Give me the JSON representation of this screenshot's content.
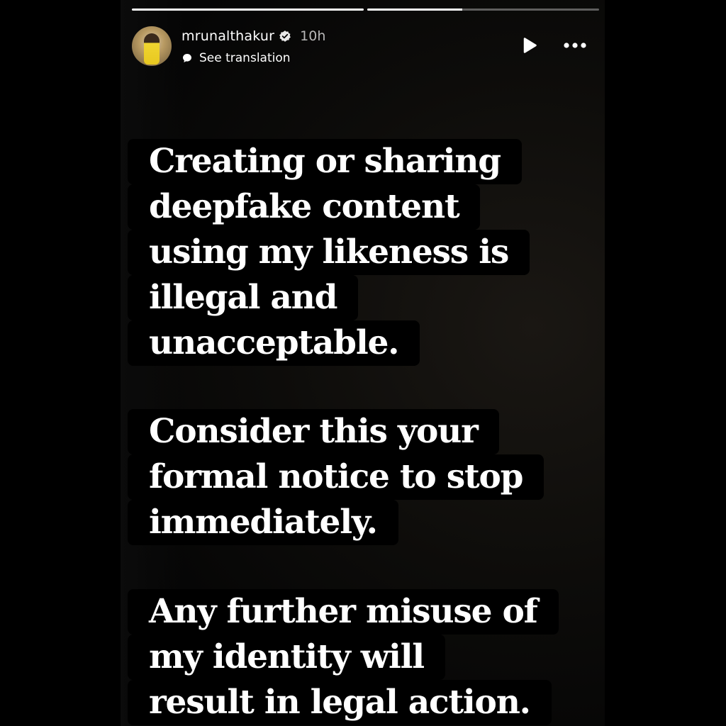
{
  "story": {
    "progress": [
      1.0,
      0.41
    ],
    "username": "mrunalthakur",
    "time": "10h",
    "translate_label": "See translation",
    "icons": {
      "avatar": "profile-photo",
      "verified": "verified-badge-icon",
      "translate": "speech-bubble-icon",
      "play": "play-icon",
      "more": "more-horizontal-icon"
    }
  },
  "content": {
    "paragraph1": [
      "Creating or sharing",
      "deepfake content",
      "using my likeness is",
      "illegal and",
      "unacceptable."
    ],
    "paragraph2": [
      "Consider this your",
      "formal notice to stop",
      "immediately."
    ],
    "paragraph3": [
      "Any further misuse of",
      "my identity will",
      "result in legal action."
    ]
  },
  "colors": {
    "background": "#000000",
    "text": "#ffffff",
    "text_highlight": "#000000",
    "muted": "#b8b8b8"
  }
}
